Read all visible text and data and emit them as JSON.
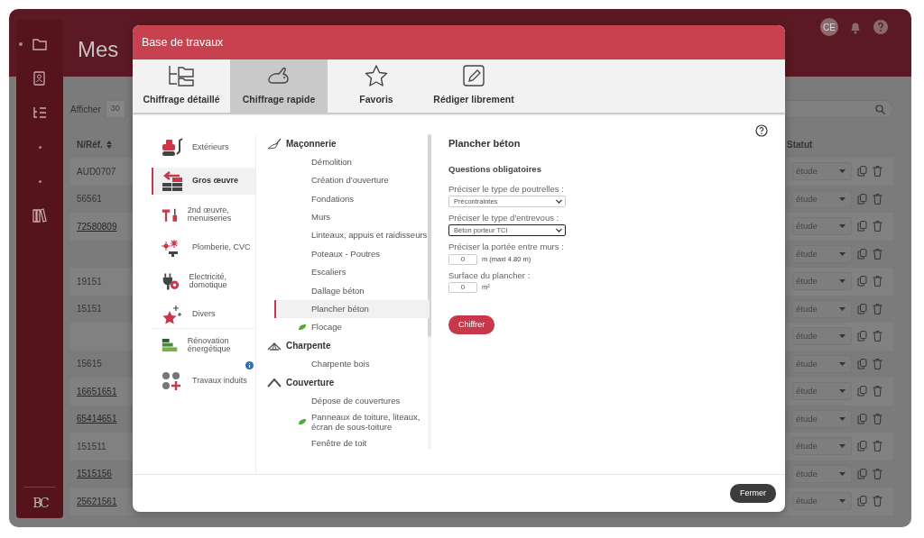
{
  "sidebar": [
    {
      "kind": "folder",
      "selected": true
    },
    {
      "kind": "contacts",
      "selected": false
    },
    {
      "kind": "list",
      "selected": false
    },
    {
      "kind": "dot",
      "selected": false
    },
    {
      "kind": "dot",
      "selected": false
    },
    {
      "kind": "books",
      "selected": false
    }
  ],
  "sidebar_logo": "BC",
  "header": {
    "title": "Mes",
    "user_initials": "CE"
  },
  "toolbar": {
    "show_label": "Afficher",
    "page_size": "30"
  },
  "table": {
    "columns": [
      "N/Réf.",
      "Statut"
    ],
    "rows": [
      {
        "ref": "AUD0707",
        "link": false,
        "status": "étude"
      },
      {
        "ref": "56561",
        "link": false,
        "status": "étude"
      },
      {
        "ref": "72580809",
        "link": true,
        "status": "étude"
      },
      {
        "status": "étude"
      },
      {
        "ref": "19151",
        "link": false,
        "status": "étude"
      },
      {
        "ref": "15151",
        "link": false,
        "status": "étude"
      },
      {
        "status": "étude"
      },
      {
        "ref": "15615",
        "link": false,
        "status": "étude"
      },
      {
        "ref": "16651651",
        "link": true,
        "status": "étude"
      },
      {
        "ref": "65414651",
        "link": true,
        "status": "étude"
      },
      {
        "ref": "151511",
        "link": false,
        "status": "étude"
      },
      {
        "ref": "1515156",
        "link": true,
        "status": "étude"
      },
      {
        "ref": "25621561",
        "link": true,
        "status": "étude"
      }
    ]
  },
  "modal": {
    "title": "Base de travaux",
    "tabs": [
      {
        "label": "Chiffrage détaillé",
        "kind": "tree",
        "selected": false
      },
      {
        "label": "Chiffrage rapide",
        "kind": "rabbit",
        "selected": true
      },
      {
        "label": "Favoris",
        "kind": "star",
        "selected": false
      },
      {
        "label": "Rédiger librement",
        "kind": "pencil",
        "selected": false
      }
    ],
    "categories": [
      {
        "label": "Extérieurs",
        "kind": "machine",
        "selected": false,
        "info": false
      },
      {
        "label": "Gros œuvre",
        "kind": "bricks",
        "selected": true,
        "info": false
      },
      {
        "label": "2nd œuvre, menuiseries",
        "kind": "tools",
        "selected": false,
        "info": false
      },
      {
        "label": "Plomberie, CVC",
        "kind": "tap",
        "selected": false,
        "info": false
      },
      {
        "label": "Electricité, domotique",
        "kind": "plug",
        "selected": false,
        "info": false
      },
      {
        "label": "Divers",
        "kind": "star",
        "selected": false,
        "info": false
      },
      {
        "label": "Rénovation énergétique",
        "kind": "energy",
        "selected": false,
        "info": false
      },
      {
        "label": "Travaux induits",
        "kind": "dots",
        "selected": false,
        "info": true
      }
    ],
    "tree": [
      {
        "label": "Maçonnerie",
        "kind": "trowel",
        "children": [
          {
            "label": "Démolition",
            "selected": false,
            "eco": false
          },
          {
            "label": "Création d'ouverture",
            "selected": false,
            "eco": false
          },
          {
            "label": "Fondations",
            "selected": false,
            "eco": false
          },
          {
            "label": "Murs",
            "selected": false,
            "eco": false
          },
          {
            "label": "Linteaux, appuis et raidisseurs",
            "selected": false,
            "eco": false
          },
          {
            "label": "Poteaux - Poutres",
            "selected": false,
            "eco": false
          },
          {
            "label": "Escaliers",
            "selected": false,
            "eco": false
          },
          {
            "label": "Dallage béton",
            "selected": false,
            "eco": false
          },
          {
            "label": "Plancher béton",
            "selected": true,
            "eco": false
          },
          {
            "label": "Flocage",
            "selected": false,
            "eco": true
          }
        ]
      },
      {
        "label": "Charpente",
        "kind": "roof",
        "children": [
          {
            "label": "Charpente bois",
            "selected": false,
            "eco": false
          }
        ]
      },
      {
        "label": "Couverture",
        "kind": "chevron",
        "children": [
          {
            "label": "Dépose de couvertures",
            "selected": false,
            "eco": false
          },
          {
            "label": "Panneaux de toiture, liteaux, écran de sous-toiture",
            "selected": false,
            "eco": true
          },
          {
            "label": "Fenêtre de toit",
            "selected": false,
            "eco": false
          }
        ]
      }
    ],
    "form": {
      "title": "Plancher béton",
      "subtitle": "Questions obligatoires",
      "fields": [
        {
          "kind": "select",
          "label": "Préciser le type de poutrelles :",
          "value": "Précontraintes",
          "focused": false
        },
        {
          "kind": "select",
          "label": "Préciser le type d'entrevous :",
          "value": "Béton porteur TCI",
          "focused": true
        },
        {
          "kind": "number",
          "label": "Préciser la portée entre murs :",
          "value": "0",
          "unit": "m (maxi 4.80 m)"
        },
        {
          "kind": "number",
          "label": "Surface du plancher :",
          "value": "0",
          "unit": "m²"
        }
      ],
      "submit": "Chiffrer"
    },
    "close": "Fermer"
  }
}
